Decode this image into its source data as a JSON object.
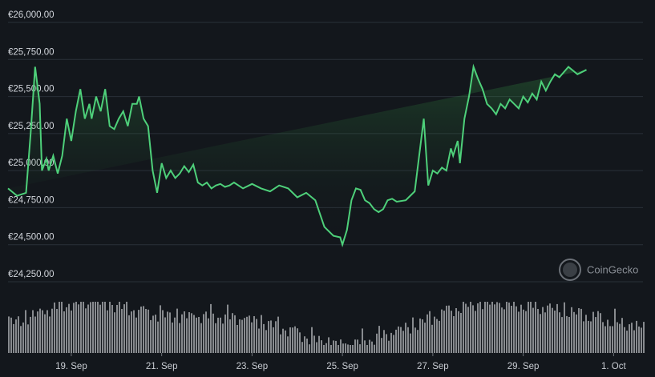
{
  "watermark": "CoinGecko",
  "colors": {
    "background": "#13171c",
    "line": "#4ed07a",
    "grid": "#2a3038",
    "volume": "#8e9196"
  },
  "chart_data": {
    "type": "line",
    "title": "",
    "xlabel": "",
    "ylabel": "",
    "currency": "EUR",
    "grid": "horizontal",
    "ylim": [
      24250,
      26000
    ],
    "y_ticks": [
      26000,
      25750,
      25500,
      25250,
      25000,
      24750,
      24500,
      24250
    ],
    "y_tick_labels": [
      "€26,000.00",
      "€25,750.00",
      "€25,500.00",
      "€25,250.00",
      "€25,000.00",
      "€24,750.00",
      "€24,500.00",
      "€24,250.00"
    ],
    "x_ticks": [
      "19. Sep",
      "21. Sep",
      "23. Sep",
      "25. Sep",
      "27. Sep",
      "29. Sep",
      "1. Oct"
    ],
    "xlim": [
      17.6,
      31.65
    ],
    "x_unit": "day of September (Sep 31 = 1 Oct)",
    "price_series": {
      "name": "Price",
      "x": [
        17.6,
        17.8,
        18.0,
        18.1,
        18.2,
        18.3,
        18.35,
        18.45,
        18.5,
        18.6,
        18.7,
        18.8,
        18.9,
        19.0,
        19.1,
        19.2,
        19.3,
        19.4,
        19.45,
        19.55,
        19.65,
        19.75,
        19.85,
        19.95,
        20.05,
        20.15,
        20.25,
        20.35,
        20.45,
        20.5,
        20.6,
        20.7,
        20.8,
        20.9,
        21.0,
        21.1,
        21.2,
        21.3,
        21.4,
        21.5,
        21.6,
        21.7,
        21.8,
        21.9,
        22.0,
        22.1,
        22.2,
        22.3,
        22.4,
        22.5,
        22.6,
        22.8,
        23.0,
        23.2,
        23.4,
        23.6,
        23.8,
        24.0,
        24.2,
        24.4,
        24.6,
        24.8,
        24.95,
        25.0,
        25.1,
        25.2,
        25.3,
        25.4,
        25.5,
        25.6,
        25.7,
        25.8,
        25.9,
        26.0,
        26.1,
        26.2,
        26.4,
        26.6,
        26.8,
        26.9,
        27.0,
        27.1,
        27.2,
        27.3,
        27.4,
        27.45,
        27.55,
        27.6,
        27.7,
        27.8,
        27.9,
        28.0,
        28.1,
        28.2,
        28.3,
        28.4,
        28.5,
        28.6,
        28.7,
        28.8,
        28.9,
        29.0,
        29.1,
        29.2,
        29.3,
        29.4,
        29.5,
        29.6,
        29.7,
        29.8,
        30.0,
        30.2,
        30.4,
        30.6,
        30.8,
        31.0,
        31.2,
        31.4,
        31.5,
        31.6,
        31.65
      ],
      "price_values": [
        24880,
        24830,
        24850,
        25250,
        25700,
        25450,
        25000,
        25080,
        25000,
        25100,
        24980,
        25100,
        25350,
        25200,
        25400,
        25550,
        25350,
        25450,
        25350,
        25500,
        25400,
        25550,
        25300,
        25280,
        25350,
        25400,
        25300,
        25450,
        25450,
        25500,
        25350,
        25300,
        25000,
        24850,
        25050,
        24950,
        25000,
        24950,
        24980,
        25030,
        24990,
        25040,
        24920,
        24900,
        24920,
        24880,
        24900,
        24910,
        24890,
        24900,
        24920,
        24880,
        24910,
        24880,
        24860,
        24900,
        24880,
        24820,
        24850,
        24800,
        24620,
        24560,
        24550,
        24500,
        24600,
        24800,
        24880,
        24870,
        24800,
        24780,
        24740,
        24720,
        24740,
        24800,
        24810,
        24790,
        24800,
        24860,
        25350,
        24900,
        25000,
        24980,
        25020,
        25000,
        25150,
        25100,
        25200,
        25050,
        25350,
        25500,
        25700,
        25620,
        25550,
        25450,
        25420,
        25380,
        25450,
        25420,
        25480,
        25450,
        25420,
        25500,
        25460,
        25520,
        25480,
        25600,
        25540,
        25600,
        25650,
        25630,
        25700,
        25650,
        25680
      ]
    },
    "volume_series": {
      "name": "Volume",
      "shape": "bars along bottom, taller around 19-20 Sep and 28-29 Sep, lower around 25 Sep"
    }
  },
  "labels": {
    "y": [
      "€26,000.00",
      "€25,750.00",
      "€25,500.00",
      "€25,250.00",
      "€25,000.00",
      "€24,750.00",
      "€24,500.00",
      "€24,250.00"
    ],
    "x": [
      "19. Sep",
      "21. Sep",
      "23. Sep",
      "25. Sep",
      "27. Sep",
      "29. Sep",
      "1. Oct"
    ]
  }
}
